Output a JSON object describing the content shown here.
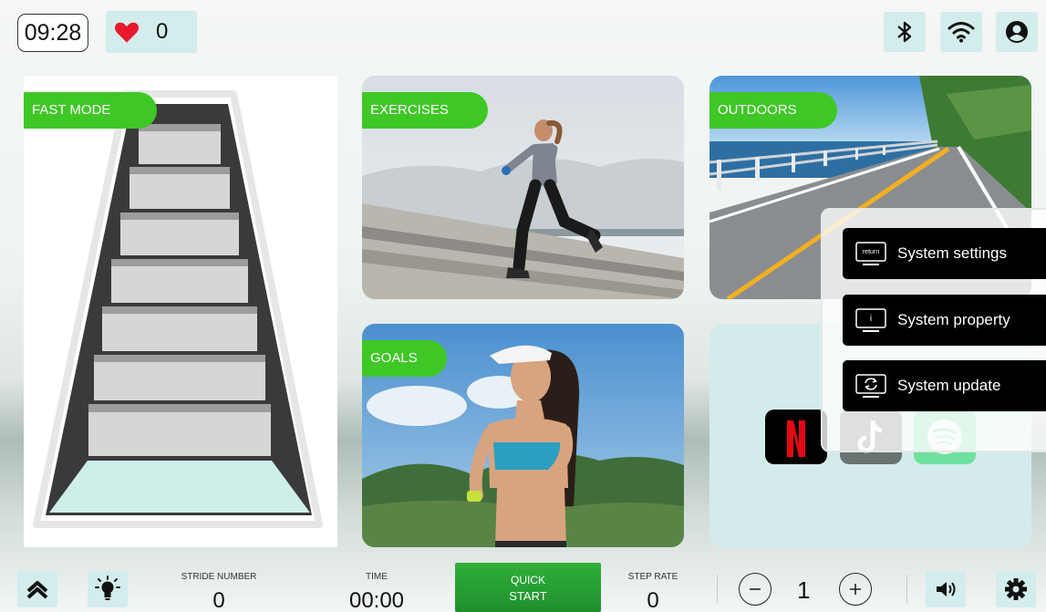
{
  "status_bar": {
    "clock": "09:28",
    "heart_rate": "0"
  },
  "cards": {
    "fast_mode": "FAST MODE",
    "exercises": "EXERCISES",
    "outdoors": "OUTDOORS",
    "goals": "GOALS"
  },
  "apps": [
    "netflix-icon",
    "tiktok-icon",
    "spotify-icon"
  ],
  "system_menu": {
    "items": [
      {
        "label": "System settings",
        "icon_text": "return"
      },
      {
        "label": "System property",
        "icon_text": "i"
      },
      {
        "label": "System update",
        "icon_text": ""
      }
    ]
  },
  "bottom_bar": {
    "stride_label": "STRIDE NUMBER",
    "stride_value": "0",
    "time_label": "TIME",
    "time_value": "00:00",
    "quick_line1": "QUICK",
    "quick_line2": "START",
    "step_rate_label": "STEP RATE",
    "step_rate_value": "0",
    "level_value": "1"
  },
  "colors": {
    "accent_green": "#3fc726",
    "tile_bg": "#d3ecec",
    "heart_red": "#e8192c"
  }
}
